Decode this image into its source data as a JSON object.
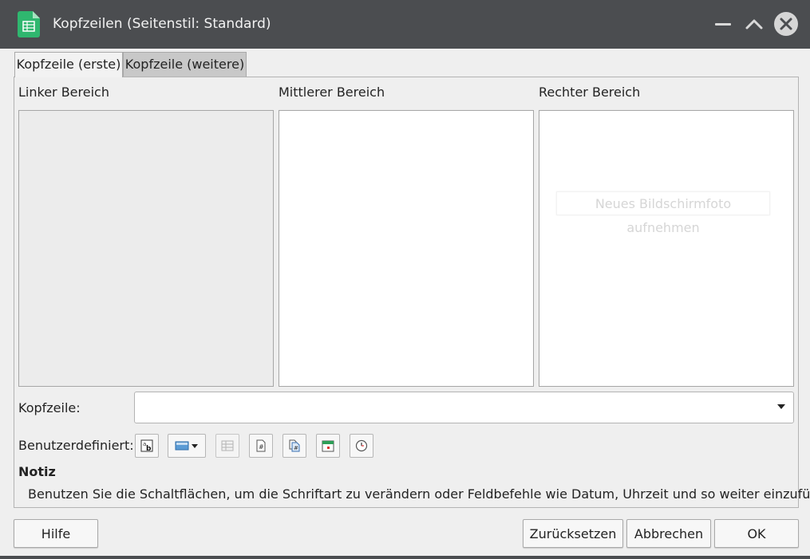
{
  "window": {
    "title": "Kopfzeilen (Seitenstil: Standard)",
    "app_icon": "spreadsheet-icon",
    "controls": [
      "minimize-icon",
      "maximize-icon",
      "close-icon"
    ]
  },
  "tabs": [
    {
      "label": "Kopfzeile (erste)",
      "active": true
    },
    {
      "label": "Kopfzeile (weitere)",
      "active": false
    }
  ],
  "areas": {
    "left_label": "Linker Bereich",
    "middle_label": "Mittlerer Bereich",
    "right_label": "Rechter Bereich"
  },
  "overlay_hint": "Neues Bildschirmfoto aufnehmen",
  "header_field": {
    "label": "Kopfzeile:",
    "value": ""
  },
  "custom": {
    "label": "Benutzerdefiniert:",
    "tools": [
      "text-attributes-icon",
      "field-dropdown-icon",
      "sheet-name-icon",
      "page-number-icon",
      "page-count-icon",
      "date-icon",
      "time-icon"
    ]
  },
  "note": {
    "title": "Notiz",
    "text": "Benutzen Sie die Schaltflächen, um die Schriftart zu verändern oder Feldbefehle wie Datum, Uhrzeit und so weiter einzufügen."
  },
  "buttons": {
    "help": "Hilfe",
    "reset": "Zurücksetzen",
    "cancel": "Abbrechen",
    "ok": "OK"
  },
  "colors": {
    "titlebar": "#4b4d50",
    "app_icon_green": "#2fb76f",
    "dialog_bg": "#efefef"
  }
}
